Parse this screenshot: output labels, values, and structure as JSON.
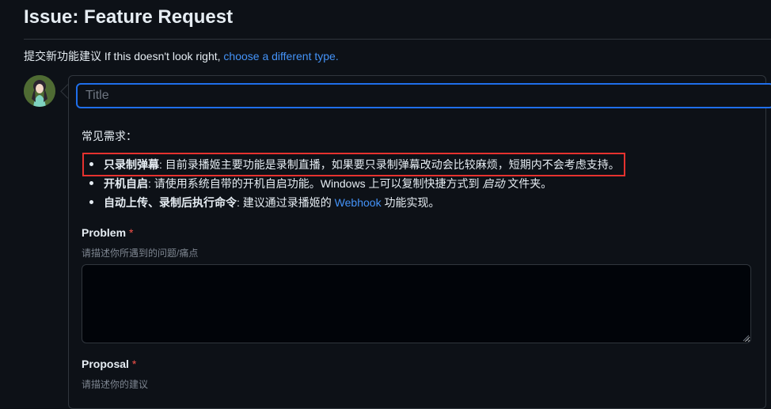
{
  "page": {
    "title": "Issue: Feature Request",
    "subtitle_text": "提交新功能建议 If this doesn't look right, ",
    "subtitle_link": "choose a different type."
  },
  "form": {
    "title_placeholder": "Title",
    "common_heading": "常见需求：",
    "faq": [
      {
        "bold": "只录制弹幕",
        "text": ": 目前录播姬主要功能是录制直播，如果要只录制弹幕改动会比较麻烦，短期内不会考虑支持。"
      },
      {
        "bold": "开机自启",
        "text": ": 请使用系统自带的开机自启功能。Windows 上可以复制快捷方式到 ",
        "italic": "启动",
        "text_after": " 文件夹。"
      },
      {
        "bold": "自动上传、录制后执行命令",
        "text": ": 建议通过录播姬的 ",
        "link": "Webhook",
        "text_after": " 功能实现。"
      }
    ],
    "problem": {
      "label": "Problem",
      "required": "*",
      "hint": "请描述你所遇到的问题/痛点",
      "value": ""
    },
    "proposal": {
      "label": "Proposal",
      "required": "*",
      "hint": "请描述你的建议"
    }
  },
  "colors": {
    "background": "#0d1117",
    "accent_link": "#4493f8",
    "focus_border": "#1f6feb",
    "highlight_box": "#e5322f",
    "required_star": "#f85149"
  }
}
